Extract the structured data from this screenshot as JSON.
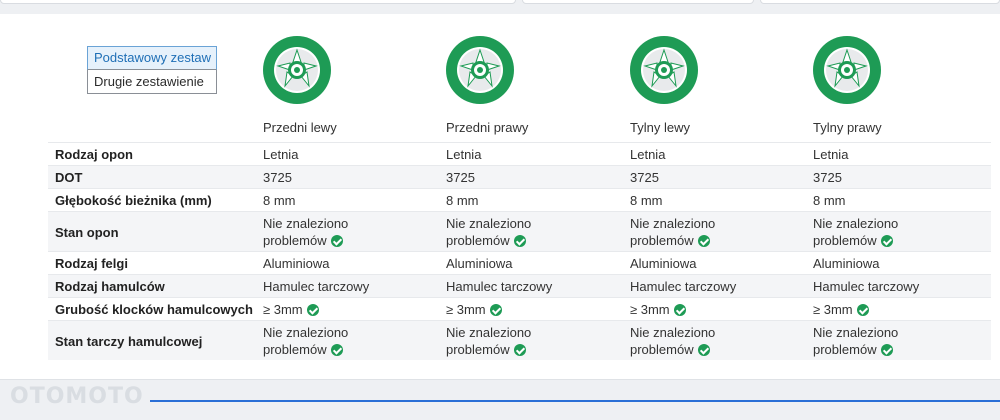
{
  "toggle": {
    "basic": "Podstawowy zestaw",
    "second": "Drugie zestawienie"
  },
  "columns": [
    {
      "label": "Przedni lewy"
    },
    {
      "label": "Przedni prawy"
    },
    {
      "label": "Tylny lewy"
    },
    {
      "label": "Tylny prawy"
    }
  ],
  "rows": [
    {
      "label": "Rodzaj opon",
      "values": [
        {
          "text": "Letnia"
        },
        {
          "text": "Letnia"
        },
        {
          "text": "Letnia"
        },
        {
          "text": "Letnia"
        }
      ]
    },
    {
      "label": "DOT",
      "values": [
        {
          "text": "3725"
        },
        {
          "text": "3725"
        },
        {
          "text": "3725"
        },
        {
          "text": "3725"
        }
      ]
    },
    {
      "label": "Głębokość bieżnika (mm)",
      "values": [
        {
          "text": "8 mm"
        },
        {
          "text": "8 mm"
        },
        {
          "text": "8 mm"
        },
        {
          "text": "8 mm"
        }
      ]
    },
    {
      "label": "Stan opon",
      "values": [
        {
          "line1": "Nie znaleziono",
          "line2": "problemów",
          "ok": true
        },
        {
          "line1": "Nie znaleziono",
          "line2": "problemów",
          "ok": true
        },
        {
          "line1": "Nie znaleziono",
          "line2": "problemów",
          "ok": true
        },
        {
          "line1": "Nie znaleziono",
          "line2": "problemów",
          "ok": true
        }
      ]
    },
    {
      "label": "Rodzaj felgi",
      "values": [
        {
          "text": "Aluminiowa"
        },
        {
          "text": "Aluminiowa"
        },
        {
          "text": "Aluminiowa"
        },
        {
          "text": "Aluminiowa"
        }
      ]
    },
    {
      "label": "Rodzaj hamulców",
      "values": [
        {
          "text": "Hamulec tarczowy"
        },
        {
          "text": "Hamulec tarczowy"
        },
        {
          "text": "Hamulec tarczowy"
        },
        {
          "text": "Hamulec tarczowy"
        }
      ]
    },
    {
      "label": "Grubość klocków hamulcowych",
      "values": [
        {
          "text": "≥ 3mm",
          "ok": true
        },
        {
          "text": "≥ 3mm",
          "ok": true
        },
        {
          "text": "≥ 3mm",
          "ok": true
        },
        {
          "text": "≥ 3mm",
          "ok": true
        }
      ]
    },
    {
      "label": "Stan tarczy hamulcowej",
      "values": [
        {
          "line1": "Nie znaleziono",
          "line2": "problemów",
          "ok": true
        },
        {
          "line1": "Nie znaleziono",
          "line2": "problemów",
          "ok": true
        },
        {
          "line1": "Nie znaleziono",
          "line2": "problemów",
          "ok": true
        },
        {
          "line1": "Nie znaleziono",
          "line2": "problemów",
          "ok": true
        }
      ]
    }
  ],
  "watermark": "OTOMOTO",
  "colors": {
    "wheel": "#1e9b55",
    "check": "#1e9b55",
    "active_toggle": "#1f6fb6",
    "alt_row": "#f4f5f7",
    "bottom_line": "#2a6fd6"
  },
  "icons": {
    "wheel": "wheel-icon",
    "check": "check-circle-icon"
  }
}
